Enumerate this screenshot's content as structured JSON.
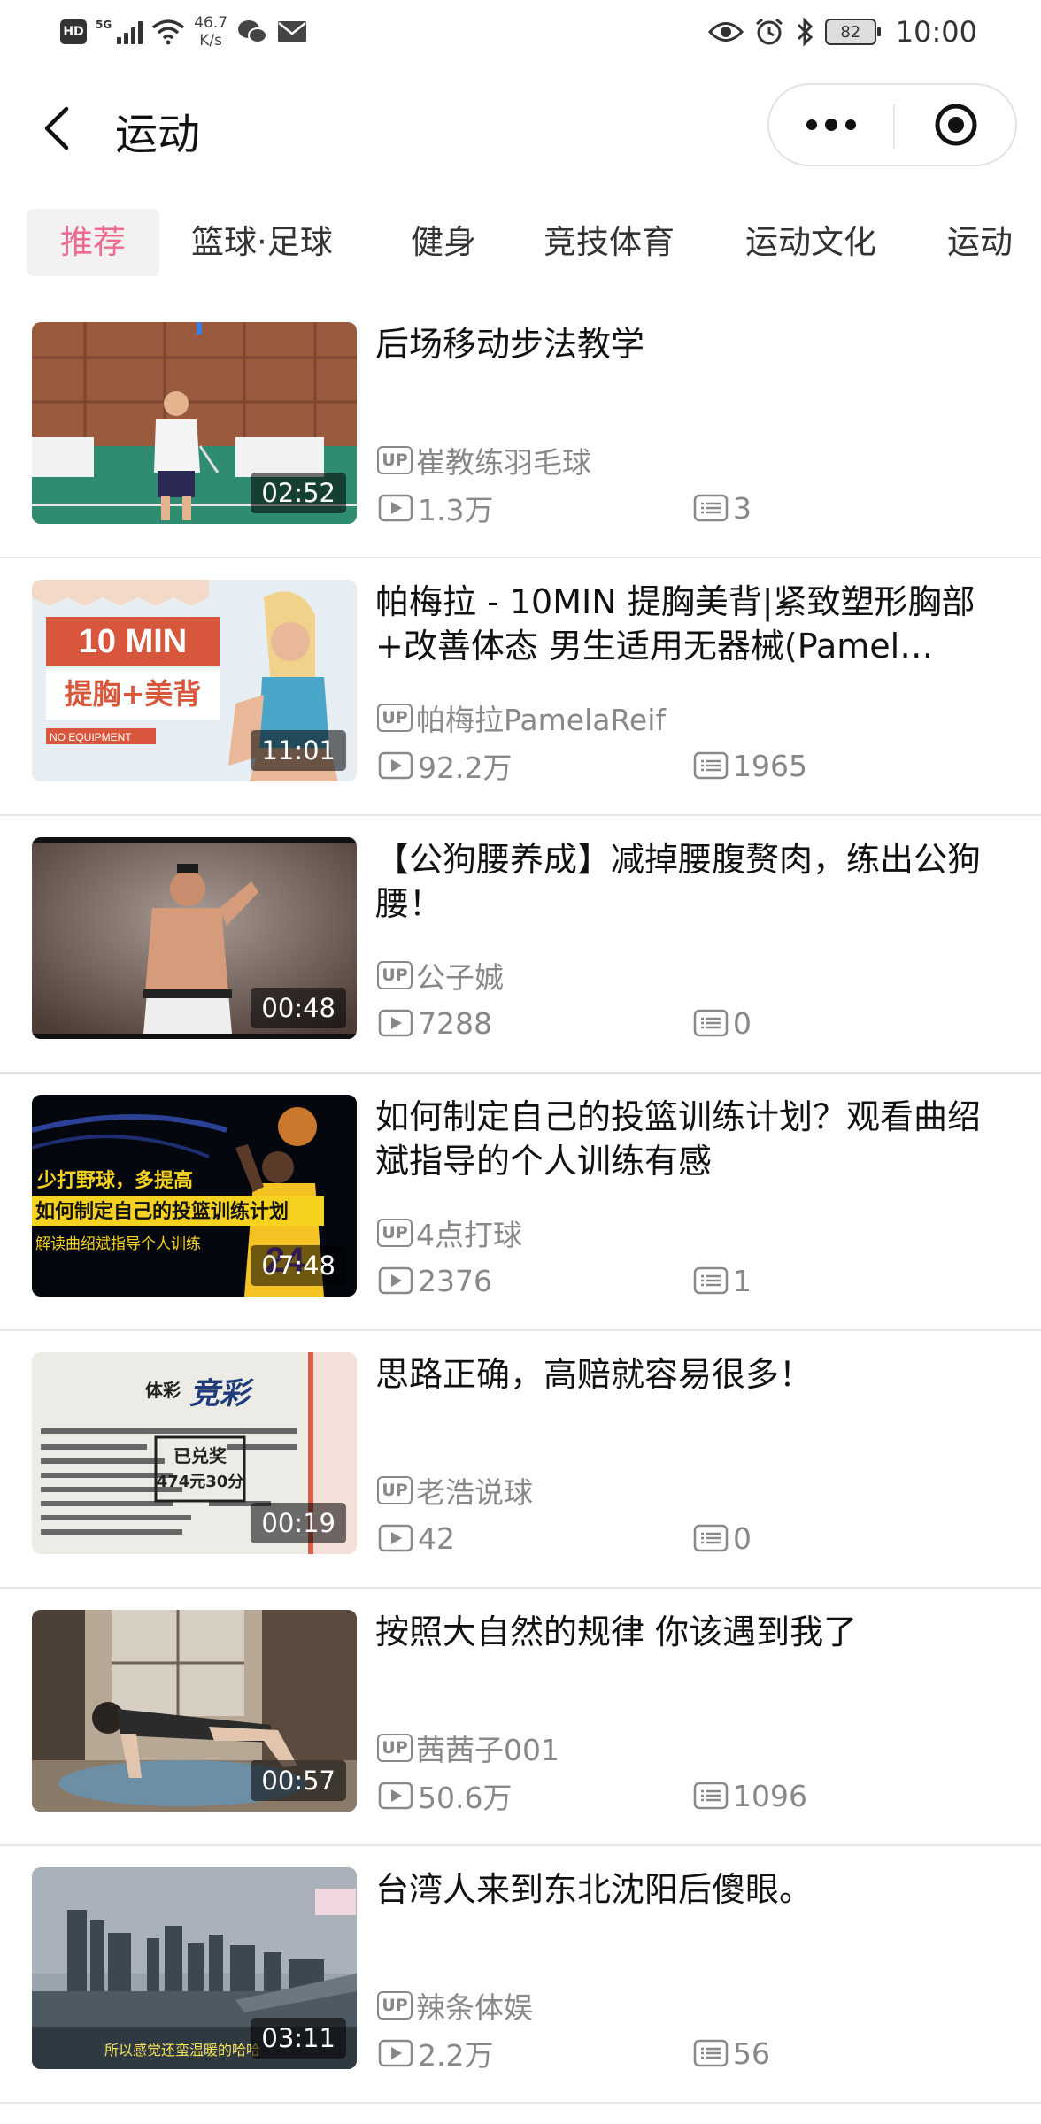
{
  "status_bar": {
    "hd": "HD",
    "network": "5G",
    "speed_value": "46.7",
    "speed_unit": "K/s",
    "battery": "82",
    "time": "10:00"
  },
  "header": {
    "title": "运动"
  },
  "tabs": [
    {
      "label": "推荐",
      "active": true
    },
    {
      "label": "篮球·足球",
      "active": false
    },
    {
      "label": "健身",
      "active": false
    },
    {
      "label": "竞技体育",
      "active": false
    },
    {
      "label": "运动文化",
      "active": false
    },
    {
      "label": "运动",
      "active": false
    }
  ],
  "videos": [
    {
      "title": "后场移动步法教学",
      "duration": "02:52",
      "uploader": "崔教练羽毛球",
      "plays": "1.3万",
      "comments": "3"
    },
    {
      "title": "帕梅拉 - 10MIN 提胸美背|紧致塑形胸部+改善体态 男生适用无器械(Pamel…",
      "duration": "11:01",
      "uploader": "帕梅拉PamelaReif",
      "plays": "92.2万",
      "comments": "1965",
      "thumb_text": {
        "badge": "10 MIN",
        "sub": "提胸+美背",
        "tag": "NO EQUIPMENT"
      }
    },
    {
      "title": "【公狗腰养成】减掉腰腹赘肉，练出公狗腰！",
      "duration": "00:48",
      "uploader": "公子娍",
      "plays": "7288",
      "comments": "0"
    },
    {
      "title": "如何制定自己的投篮训练计划？观看曲绍斌指导的个人训练有感",
      "duration": "07:48",
      "uploader": "4点打球",
      "plays": "2376",
      "comments": "1",
      "thumb_text": {
        "line1": "少打野球，多提高",
        "line2": "如何制定自己的投篮训练计划",
        "line3": "解读曲绍斌指导个人训练",
        "jersey": "24"
      }
    },
    {
      "title": "思路正确，高赔就容易很多！",
      "duration": "00:19",
      "uploader": "老浩说球",
      "plays": "42",
      "comments": "0",
      "thumb_text": {
        "brand": "体彩",
        "logo": "竞彩",
        "stamp1": "已兑奖",
        "stamp2": "474元30分"
      }
    },
    {
      "title": "按照大自然的规律 你该遇到我了",
      "duration": "00:57",
      "uploader": "茜茜子001",
      "plays": "50.6万",
      "comments": "1096"
    },
    {
      "title": "台湾人来到东北沈阳后傻眼。",
      "duration": "03:11",
      "uploader": "辣条体娱",
      "plays": "2.2万",
      "comments": "56",
      "thumb_text": {
        "subtitle": "所以感觉还蛮温暖的哈哈"
      }
    }
  ],
  "labels": {
    "up_badge": "UP"
  }
}
